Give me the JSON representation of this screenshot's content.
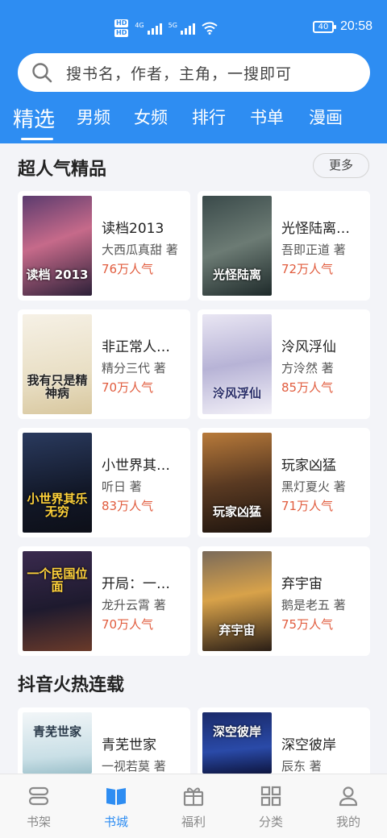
{
  "status_bar": {
    "time": "20:58",
    "battery": "40",
    "hd1": "HD",
    "hd2": "HD",
    "net1": "4G",
    "net2": "5G"
  },
  "search": {
    "placeholder": "搜书名，作者，主角，一搜即可"
  },
  "tabs": [
    "精选",
    "男频",
    "女频",
    "排行",
    "书单",
    "漫画"
  ],
  "active_tab": "精选",
  "sections": [
    {
      "title": "超人气精品",
      "more": "更多"
    },
    {
      "title": "抖音火热连载"
    }
  ],
  "books": [
    {
      "title": "读档2013",
      "author": "大西瓜真甜 著",
      "popularity": "76万人气",
      "cover_text": "读档 2013"
    },
    {
      "title": "光怪陆离…",
      "author": "吾即正道 著",
      "popularity": "72万人气",
      "cover_text": "光怪陆离"
    },
    {
      "title": "非正常人…",
      "author": "精分三代 著",
      "popularity": "70万人气",
      "cover_text": "我有只是精神病"
    },
    {
      "title": "泠风浮仙",
      "author": "方泠然 著",
      "popularity": "85万人气",
      "cover_text": "泠风浮仙"
    },
    {
      "title": "小世界其…",
      "author": "听日 著",
      "popularity": "83万人气",
      "cover_text": "小世界其乐无穷"
    },
    {
      "title": "玩家凶猛",
      "author": "黑灯夏火 著",
      "popularity": "71万人气",
      "cover_text": "玩家凶猛"
    },
    {
      "title": "开局：一…",
      "author": "龙升云霄 著",
      "popularity": "70万人气",
      "cover_text": "一个民国位面"
    },
    {
      "title": "弃宇宙",
      "author": "鹅是老五 著",
      "popularity": "75万人气",
      "cover_text": "弃宇宙"
    },
    {
      "title": "青芜世家",
      "author": "一视若莫 著",
      "popularity": "",
      "cover_text": "青芜世家"
    },
    {
      "title": "深空彼岸",
      "author": "辰东 著",
      "popularity": "",
      "cover_text": "深空彼岸"
    }
  ],
  "bottom_nav": [
    {
      "label": "书架",
      "icon": "bookshelf-icon"
    },
    {
      "label": "书城",
      "icon": "book-open-icon"
    },
    {
      "label": "福利",
      "icon": "gift-icon"
    },
    {
      "label": "分类",
      "icon": "grid-icon"
    },
    {
      "label": "我的",
      "icon": "user-icon"
    }
  ],
  "colors": {
    "brand": "#2e8df2",
    "popularity": "#e15c3e",
    "background": "#f3f4f8"
  }
}
